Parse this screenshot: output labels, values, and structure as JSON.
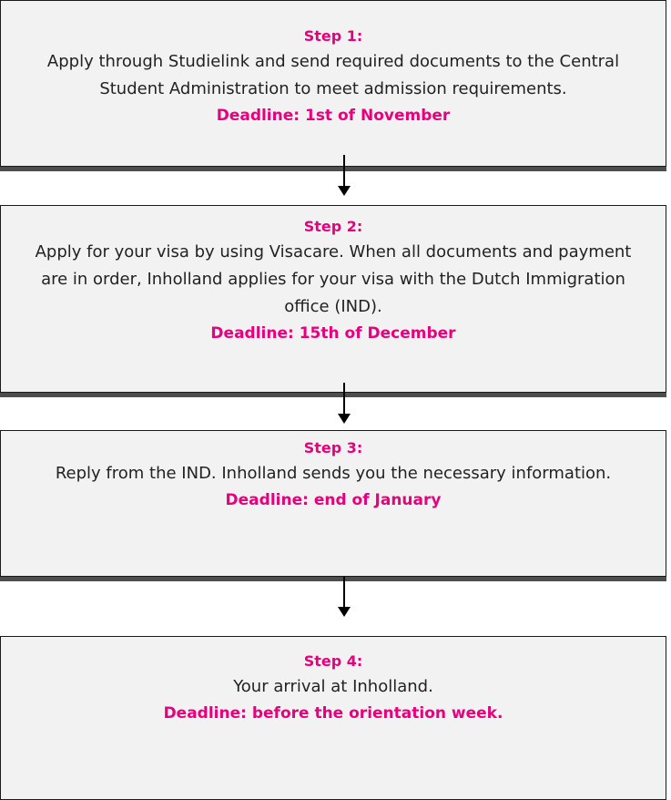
{
  "accent_color": "#e6007e",
  "steps": [
    {
      "title": "Step 1:",
      "description": "Apply through Studielink and send required documents to the Central Student Administration to meet admission requirements.",
      "deadline": "Deadline: 1st of November"
    },
    {
      "title": "Step 2:",
      "description": "Apply for your visa by using Visacare. When all documents and payment are in order, Inholland applies for your visa with the Dutch Immigration office (IND).",
      "deadline": "Deadline: 15th of December"
    },
    {
      "title": "Step 3:",
      "description": "Reply from the IND. Inholland sends you the necessary information.",
      "deadline": "Deadline: end of January"
    },
    {
      "title": "Step 4:",
      "description": "Your arrival at Inholland.",
      "deadline": "Deadline: before the orientation week."
    }
  ]
}
